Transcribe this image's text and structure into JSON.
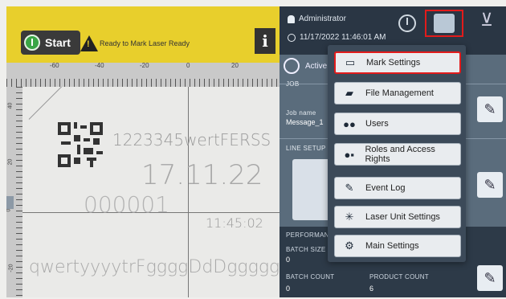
{
  "left": {
    "start_label": "Start",
    "status_text": "Ready to Mark  Laser Ready",
    "info_label": "i",
    "ruler_labels": [
      "-60",
      "-40",
      "-20",
      "0",
      "20"
    ],
    "vruler_labels": [
      "40",
      "20",
      "0",
      "-20"
    ],
    "canvas_lines": [
      "1223345wertFERSS",
      "17.11.22",
      "000001",
      "11:45:02",
      "qwertyyyytrFggggDdDggggg"
    ]
  },
  "header": {
    "user": "Administrator",
    "datetime": "11/17/2022 11:46:01 AM"
  },
  "right": {
    "active_label": "Active",
    "job_label": "JOB",
    "job_name_label": "Job name",
    "job_name_value": "Message_1",
    "line_setup_label": "LINE SETUP",
    "performance_label": "PERFORMANC",
    "batch_size_label": "BATCH SIZE",
    "batch_size_value": "0",
    "batch_count_label": "BATCH COUNT",
    "batch_count_value": "0",
    "product_count_label": "PRODUCT COUNT",
    "product_count_value": "6"
  },
  "menu": {
    "items": [
      {
        "label": "Mark Settings",
        "icon": "mark-settings-icon",
        "selected": true
      },
      {
        "label": "File Management",
        "icon": "folder-icon",
        "selected": false
      },
      {
        "label": "Users",
        "icon": "users-icon",
        "selected": false
      },
      {
        "label": "Roles and Access Rights",
        "icon": "roles-icon",
        "selected": false
      },
      {
        "label": "Event Log",
        "icon": "event-log-icon",
        "selected": false
      },
      {
        "label": "Laser Unit Settings",
        "icon": "laser-icon",
        "selected": false
      },
      {
        "label": "Main Settings",
        "icon": "main-settings-icon",
        "selected": false
      }
    ]
  },
  "colors": {
    "header_yellow": "#e8cf2c",
    "panel_slate": "#5a6c7c",
    "highlight_red": "#e21b1b"
  }
}
